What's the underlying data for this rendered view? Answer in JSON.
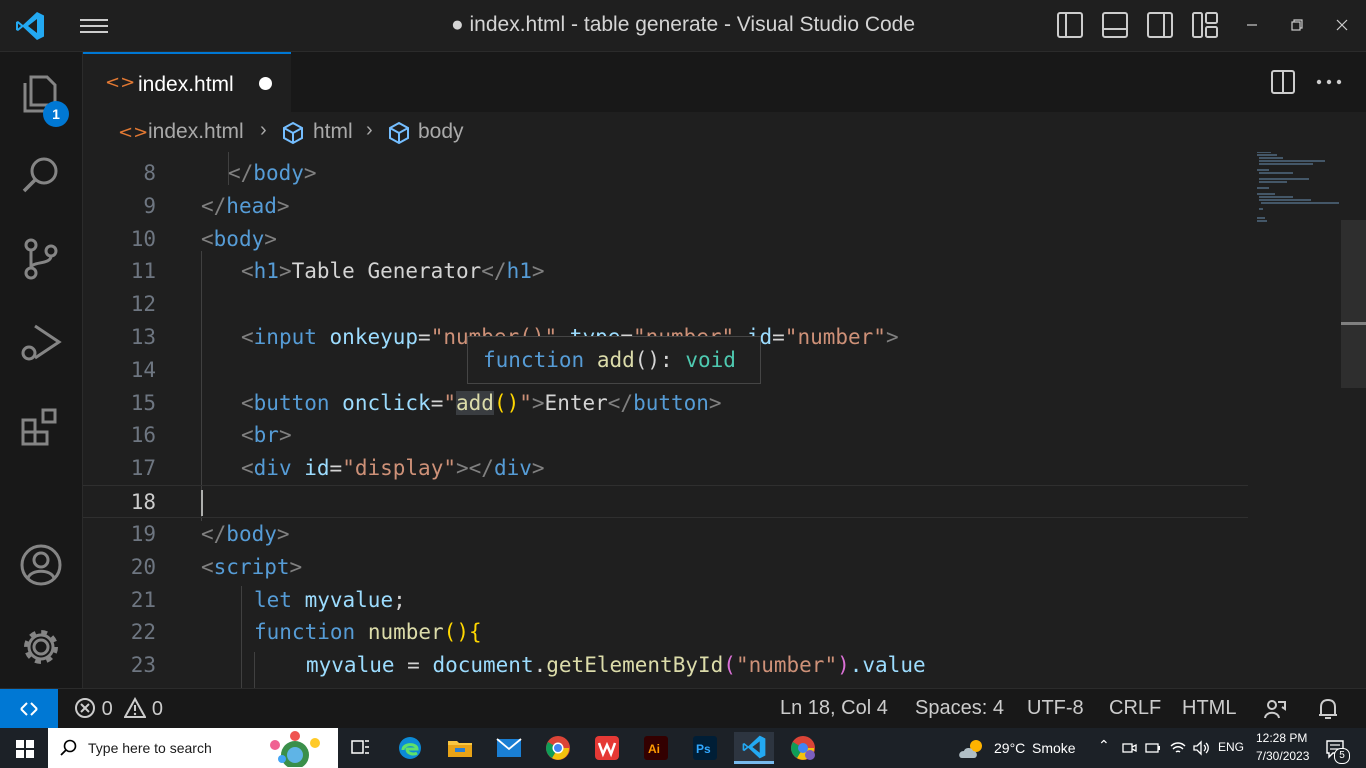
{
  "window": {
    "title": "● index.html - table generate - Visual Studio Code"
  },
  "activity_bar": {
    "explorer_badge": "1"
  },
  "tab": {
    "label": "index.html"
  },
  "breadcrumb": {
    "file": "index.html",
    "html": "html",
    "body": "body"
  },
  "editor": {
    "line_numbers": [
      "8",
      "9",
      "10",
      "11",
      "12",
      "13",
      "14",
      "15",
      "16",
      "17",
      "18",
      "19",
      "20",
      "21",
      "22",
      "23"
    ],
    "current_line": "18",
    "hover": {
      "keyword": "function",
      "name": "add",
      "sig": "():",
      "ret": "void"
    },
    "code": {
      "l8_tag": "body",
      "l9_tag": "head",
      "l10_tag": "body",
      "l11_tag": "h1",
      "l11_text": "Table Generator",
      "l13_tag": "input",
      "l13_attr1": "onkeyup",
      "l13_val1": "\"number()\"",
      "l13_attr2": "type",
      "l13_val2": "\"number\"",
      "l13_attr3": "id",
      "l13_val3": "\"number\"",
      "l15_tag": "button",
      "l15_attr": "onclick",
      "l15_q1": "\"",
      "l15_fn": "add",
      "l15_paren": "()",
      "l15_q2": "\"",
      "l15_text": "Enter",
      "l16_tag": "br",
      "l17_tag": "div",
      "l17_attr": "id",
      "l17_val": "\"display\"",
      "l19_tag": "body",
      "l20_tag": "script",
      "l21_kw": "let",
      "l21_var": "myvalue",
      "l21_end": ";",
      "l22_kw": "function",
      "l22_fn": "number",
      "l22_p": "(){",
      "l23_var": "myvalue",
      "l23_eq": " = ",
      "l23_obj": "document",
      "l23_dot": ".",
      "l23_fn": "getElementById",
      "l23_p1": "(",
      "l23_arg": "\"number\"",
      "l23_p2": ")",
      "l23_prop": ".value"
    }
  },
  "status_bar": {
    "errors": "0",
    "warnings": "0",
    "position": "Ln 18, Col 4",
    "spaces": "Spaces: 4",
    "encoding": "UTF-8",
    "eol": "CRLF",
    "language": "HTML"
  },
  "taskbar": {
    "search_placeholder": "Type here to search",
    "weather_temp": "29°C",
    "weather_desc": "Smoke",
    "language": "ENG",
    "time": "12:28 PM",
    "date": "7/30/2023",
    "notification_count": "5"
  },
  "colors": {
    "accent": "#0078d4",
    "editor_bg": "#1f1f1f",
    "tag": "#569cd6",
    "attr": "#9cdcfe",
    "string": "#ce9178"
  }
}
